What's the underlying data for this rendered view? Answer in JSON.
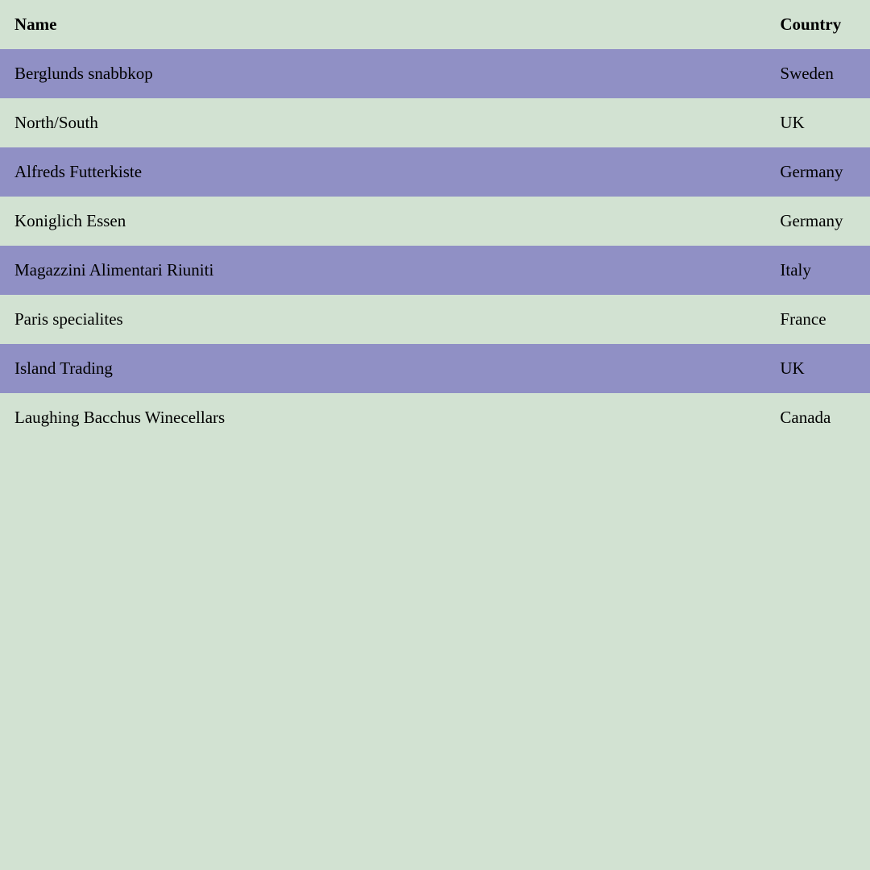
{
  "table": {
    "headers": {
      "name": "Name",
      "country": "Country"
    },
    "rows": [
      {
        "name": "Berglunds snabbkop",
        "country": "Sweden"
      },
      {
        "name": "North/South",
        "country": "UK"
      },
      {
        "name": "Alfreds Futterkiste",
        "country": "Germany"
      },
      {
        "name": "Koniglich Essen",
        "country": "Germany"
      },
      {
        "name": "Magazzini Alimentari Riuniti",
        "country": "Italy"
      },
      {
        "name": "Paris specialites",
        "country": "France"
      },
      {
        "name": "Island Trading",
        "country": "UK"
      },
      {
        "name": "Laughing Bacchus Winecellars",
        "country": "Canada"
      }
    ]
  },
  "colors": {
    "background": "#d2e2d2",
    "stripe": "#9090c5"
  }
}
